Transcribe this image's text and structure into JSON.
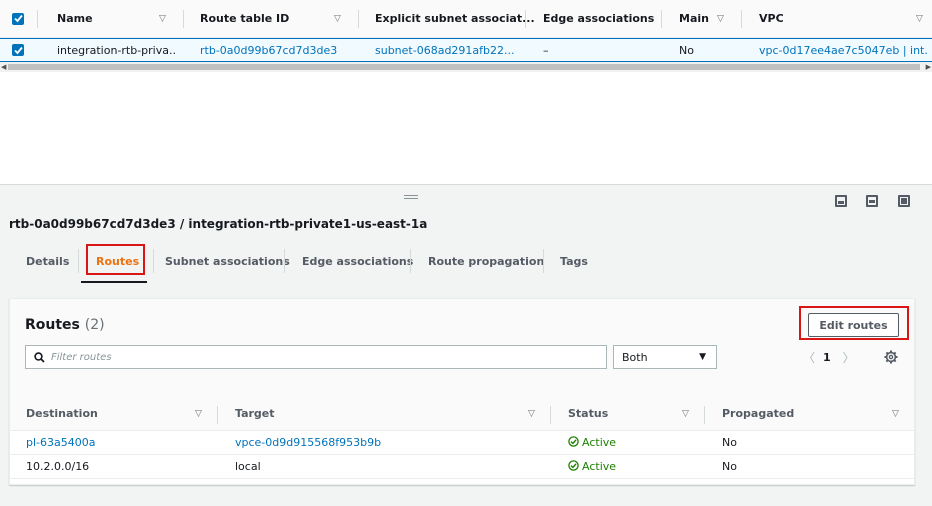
{
  "top_table": {
    "columns": [
      "Name",
      "Route table ID",
      "Explicit subnet associat...",
      "Edge associations",
      "Main",
      "VPC"
    ],
    "row": {
      "name": "integration-rtb-priva...",
      "route_table_id": "rtb-0a0d99b67cd7d3de3",
      "subnet": "subnet-068ad291afb22...",
      "edge": "–",
      "main": "No",
      "vpc": "vpc-0d17ee4ae7c5047eb | int..."
    }
  },
  "panel": {
    "title": "rtb-0a0d99b67cd7d3de3 / integration-rtb-private1-us-east-1a",
    "tabs": [
      "Details",
      "Routes",
      "Subnet associations",
      "Edge associations",
      "Route propagation",
      "Tags"
    ],
    "active_tab": "Routes"
  },
  "routes": {
    "title": "Routes",
    "count": "(2)",
    "edit_button": "Edit routes",
    "search_placeholder": "Filter routes",
    "filter_select": "Both",
    "page": "1",
    "columns": [
      "Destination",
      "Target",
      "Status",
      "Propagated"
    ],
    "rows": [
      {
        "destination": "pl-63a5400a",
        "target": "vpce-0d9d915568f953b9b",
        "status": "Active",
        "propagated": "No"
      },
      {
        "destination": "10.2.0.0/16",
        "target": "local",
        "status": "Active",
        "propagated": "No"
      }
    ]
  },
  "colors": {
    "link": "#0073bb",
    "active_tab": "#ec7211",
    "highlight_box": "#d91515",
    "status_active": "#1d8102"
  }
}
